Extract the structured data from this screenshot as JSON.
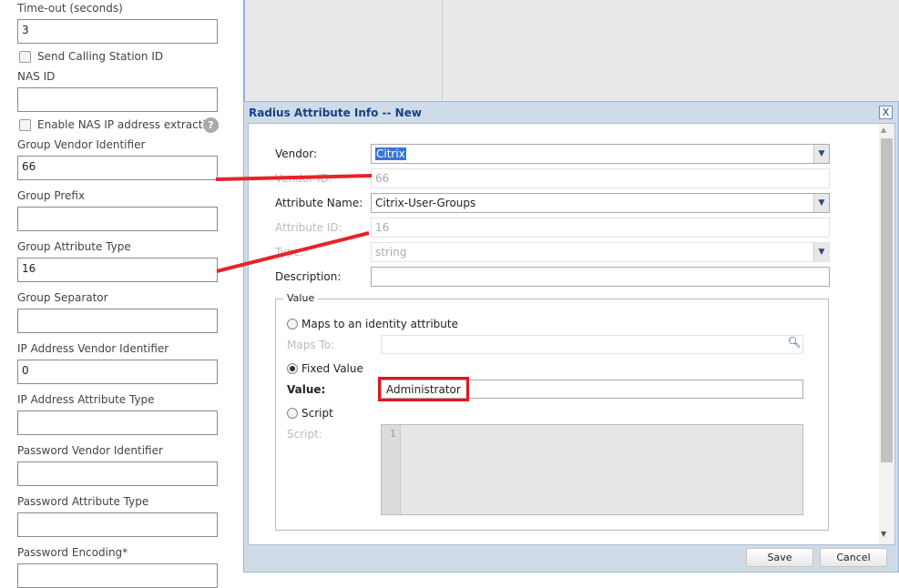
{
  "left_form": {
    "timeout_label": "Time-out (seconds)",
    "timeout_value": "3",
    "send_calling_station": "Send Calling Station ID",
    "nas_id_label": "NAS ID",
    "nas_id_value": "",
    "enable_nas_ip": "Enable NAS IP address extraction",
    "help_icon": "?",
    "group_vendor_label": "Group Vendor Identifier",
    "group_vendor_value": "66",
    "group_prefix_label": "Group Prefix",
    "group_attr_type_label": "Group Attribute Type",
    "group_attr_type_value": "16",
    "group_separator_label": "Group Separator",
    "ip_vendor_label": "IP Address Vendor Identifier",
    "ip_vendor_value": "0",
    "ip_attr_type_label": "IP Address Attribute Type",
    "pw_vendor_label": "Password Vendor Identifier",
    "pw_attr_type_label": "Password Attribute Type",
    "pw_encoding_label": "Password Encoding*"
  },
  "dialog": {
    "title": "Radius Attribute Info -- New",
    "close": "X",
    "vendor_label": "Vendor:",
    "vendor_value": "Citrix",
    "vendor_id_label": "Vendor ID:",
    "vendor_id_value": "66",
    "attr_name_label": "Attribute Name:",
    "attr_name_value": "Citrix-User-Groups",
    "attr_id_label": "Attribute ID:",
    "attr_id_value": "16",
    "type_label": "Type:",
    "type_value": "string",
    "description_label": "Description:",
    "description_value": "",
    "value_legend": "Value",
    "maps_identity": "Maps to an identity attribute",
    "maps_to_label": "Maps To:",
    "fixed_value": "Fixed Value",
    "value_label": "Value:",
    "value_value": "Administrator",
    "script": "Script",
    "script_label": "Script:",
    "line_number": "1",
    "save": "Save",
    "cancel": "Cancel"
  },
  "colors": {
    "annotation": "#e8222a",
    "title": "#15428b"
  }
}
